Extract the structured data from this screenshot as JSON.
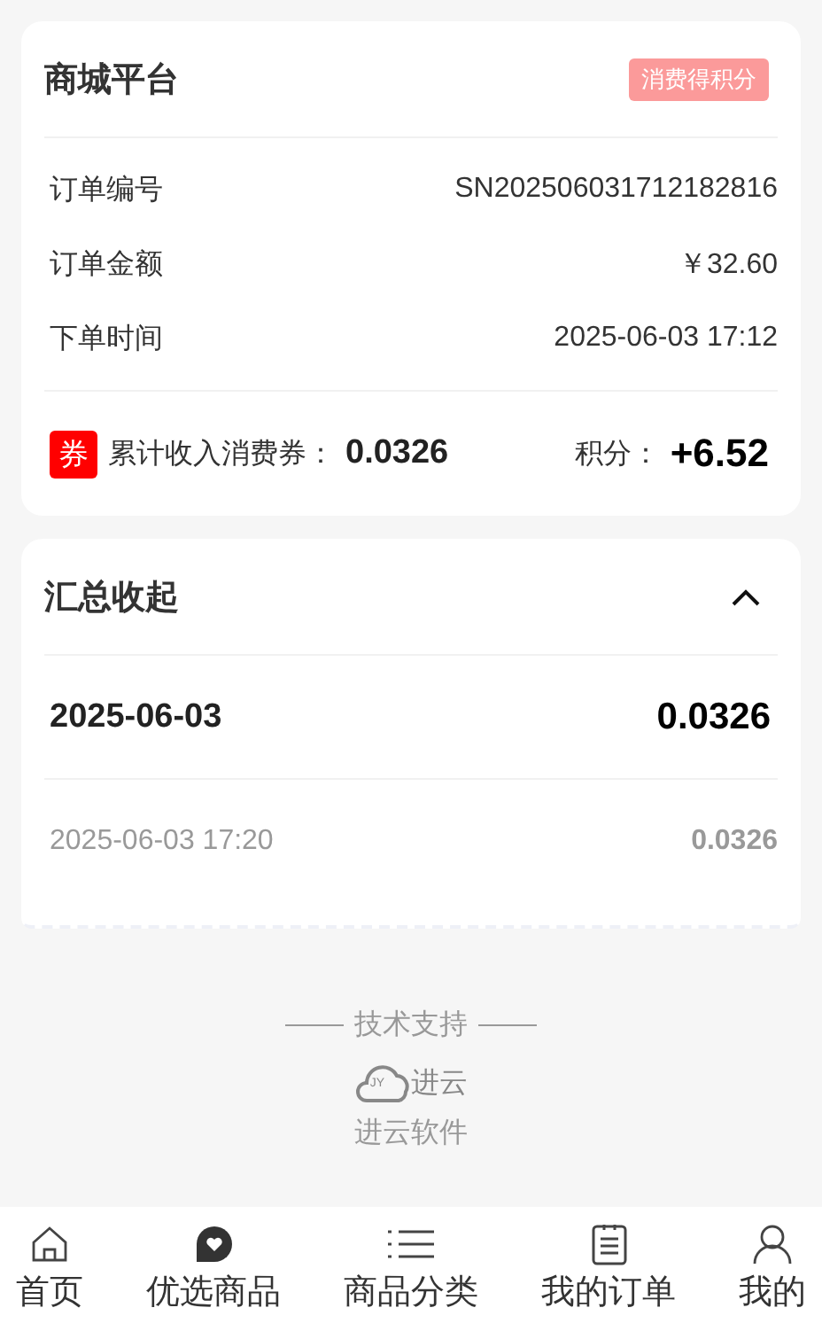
{
  "order_card": {
    "title": "商城平台",
    "badge": "消费得积分",
    "fields": [
      {
        "label": "订单编号",
        "value": "SN202506031712182816"
      },
      {
        "label": "订单金额",
        "value": "￥32.60"
      },
      {
        "label": "下单时间",
        "value": "2025-06-03 17:12"
      }
    ],
    "coupon": {
      "tag": "券",
      "label": "累计收入消费券：",
      "value": "0.0326"
    },
    "points": {
      "label": "积分：",
      "value": "+6.52"
    }
  },
  "summary": {
    "title": "汇总收起",
    "expanded": true,
    "groups": [
      {
        "date": "2025-06-03",
        "total": "0.0326",
        "entries": [
          {
            "time": "2025-06-03 17:20",
            "amount": "0.0326"
          }
        ]
      }
    ]
  },
  "footer": {
    "caption": "技术支持",
    "logo_badge": "JY",
    "logo_text": "进云",
    "company": "进云软件"
  },
  "tab_bar": [
    {
      "kind": "home",
      "label": "首页"
    },
    {
      "kind": "heart",
      "label": "优选商品"
    },
    {
      "kind": "list",
      "label": "商品分类"
    },
    {
      "kind": "clipboard",
      "label": "我的订单"
    },
    {
      "kind": "user",
      "label": "我的"
    }
  ]
}
